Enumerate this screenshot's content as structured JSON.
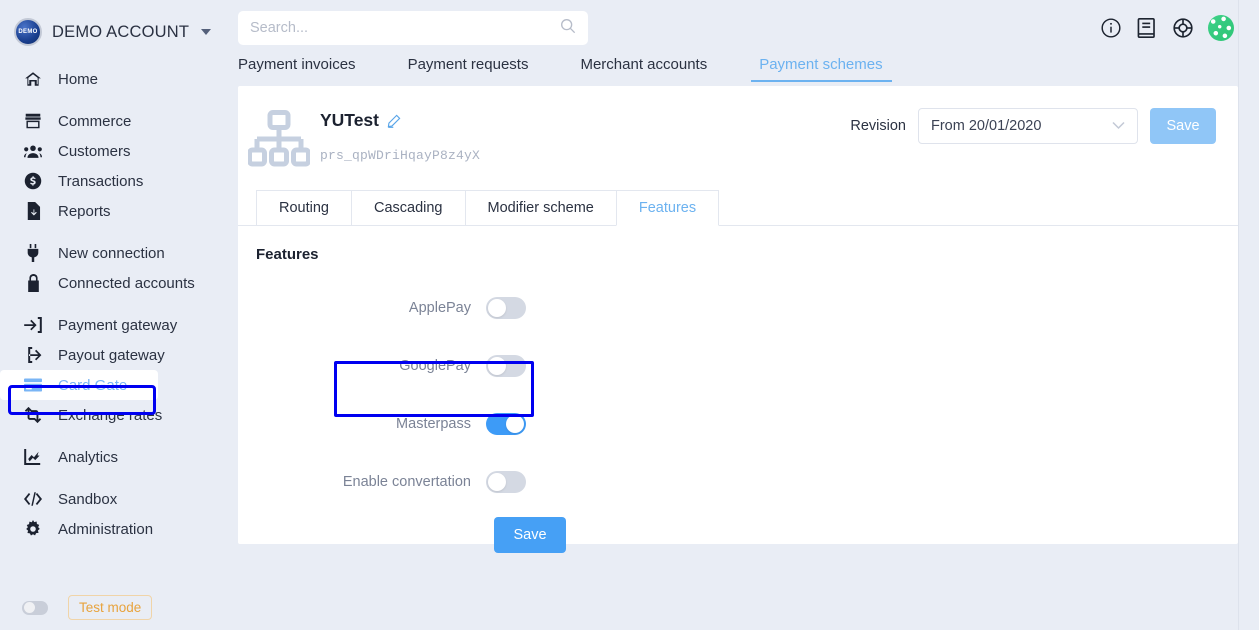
{
  "sidebar": {
    "account": {
      "name": "DEMO ACCOUNT",
      "avatar_label": "DEMO",
      "chevron_icon": "chevron-down-icon"
    },
    "groups": [
      {
        "items": [
          {
            "label": "Home",
            "icon": "home-icon",
            "active": false
          }
        ]
      },
      {
        "items": [
          {
            "label": "Commerce",
            "icon": "store-icon",
            "active": false
          },
          {
            "label": "Customers",
            "icon": "users-icon",
            "active": false
          },
          {
            "label": "Transactions",
            "icon": "dollar-circle-icon",
            "active": false
          },
          {
            "label": "Reports",
            "icon": "file-report-icon",
            "active": false
          }
        ]
      },
      {
        "items": [
          {
            "label": "New connection",
            "icon": "plug-icon",
            "active": false
          },
          {
            "label": "Connected accounts",
            "icon": "lock-icon",
            "active": false
          }
        ]
      },
      {
        "items": [
          {
            "label": "Payment gateway",
            "icon": "sign-in-icon",
            "active": false
          },
          {
            "label": "Payout gateway",
            "icon": "sign-out-icon",
            "active": false
          },
          {
            "label": "Card Gate",
            "icon": "credit-card-icon",
            "active": true
          },
          {
            "label": "Exchange rates",
            "icon": "exchange-icon",
            "active": false
          }
        ]
      },
      {
        "items": [
          {
            "label": "Analytics",
            "icon": "chart-line-icon",
            "active": false
          }
        ]
      },
      {
        "items": [
          {
            "label": "Sandbox",
            "icon": "code-icon",
            "active": false
          },
          {
            "label": "Administration",
            "icon": "gear-icon",
            "active": false
          }
        ]
      }
    ],
    "test_mode": {
      "label": "Test mode",
      "enabled": false
    }
  },
  "topbar": {
    "search": {
      "value": "",
      "placeholder": "Search...",
      "icon": "search-icon"
    },
    "icons": [
      {
        "name": "info-circle-icon"
      },
      {
        "name": "book-icon"
      },
      {
        "name": "lifebuoy-support-icon"
      },
      {
        "name": "user-avatar"
      }
    ]
  },
  "main_tabs": [
    {
      "label": "Payment invoices",
      "active": false
    },
    {
      "label": "Payment requests",
      "active": false
    },
    {
      "label": "Merchant accounts",
      "active": false
    },
    {
      "label": "Payment schemes",
      "active": true
    }
  ],
  "scheme": {
    "icon": "sitemap-icon",
    "title": "YUTest",
    "edit_icon": "pencil-icon",
    "id": "prs_qpWDriHqayP8z4yX",
    "revision_label": "Revision",
    "revision_value": "From 20/01/2020",
    "revision_chevron": "chevron-down-icon",
    "save_top_label": "Save"
  },
  "inner_tabs": [
    {
      "label": "Routing",
      "active": false
    },
    {
      "label": "Cascading",
      "active": false
    },
    {
      "label": "Modifier scheme",
      "active": false
    },
    {
      "label": "Features",
      "active": true
    }
  ],
  "features": {
    "heading": "Features",
    "rows": [
      {
        "label": "ApplePay",
        "enabled": false,
        "highlighted": false
      },
      {
        "label": "GooglePay",
        "enabled": false,
        "highlighted": false
      },
      {
        "label": "Masterpass",
        "enabled": true,
        "highlighted": true
      },
      {
        "label": "Enable convertation",
        "enabled": false,
        "highlighted": false
      }
    ],
    "save_label": "Save"
  },
  "colors": {
    "accent_blue": "#46a0f5",
    "active_link": "#6cb2f0",
    "page_bg": "#e9edf5",
    "highlight_box": "#0000f0",
    "test_mode_orange": "#e8a33d",
    "toggle_on": "#3d9bf7",
    "toggle_off": "#d4d9e3"
  }
}
